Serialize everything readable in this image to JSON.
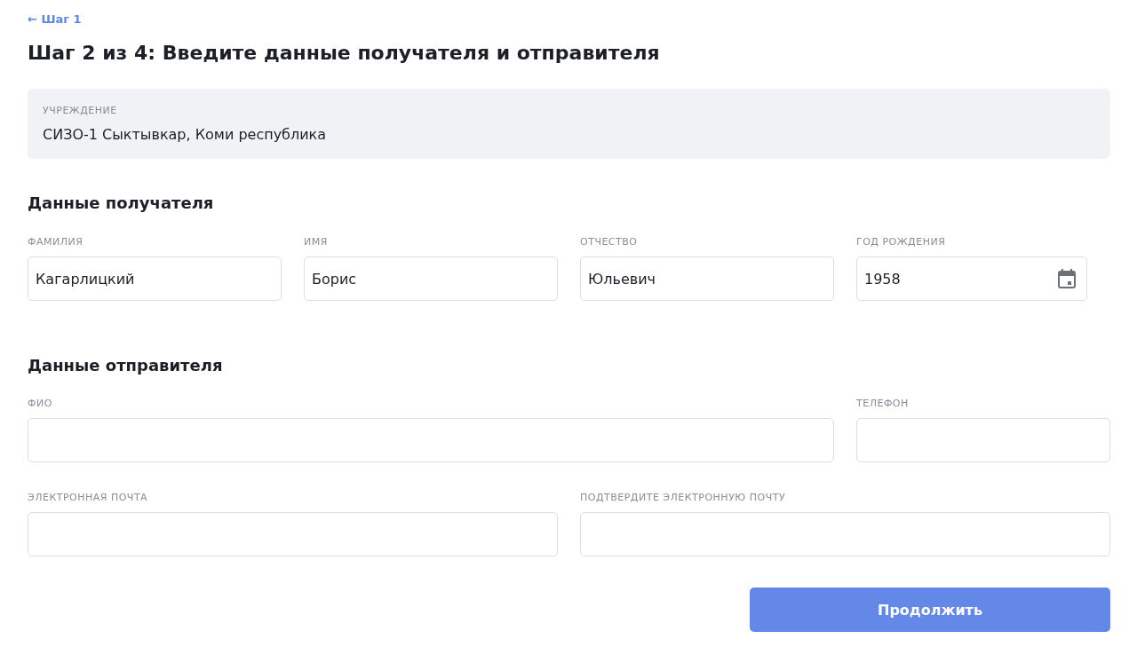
{
  "back_link": {
    "arrow": "←",
    "label": "Шаг 1"
  },
  "title": "Шаг 2 из 4: Введите данные получателя и отправителя",
  "institution": {
    "label": "УЧРЕЖДЕНИЕ",
    "value": "СИЗО-1 Сыктывкар, Коми республика"
  },
  "recipient": {
    "heading": "Данные получателя",
    "fields": [
      {
        "label": "ФАМИЛИЯ",
        "value": "Кагарлицкий",
        "kind": "text"
      },
      {
        "label": "ИМЯ",
        "value": "Борис",
        "kind": "text"
      },
      {
        "label": "ОТЧЕСТВО",
        "value": "Юльевич",
        "kind": "text"
      },
      {
        "label": "ГОД РОЖДЕНИЯ",
        "value": "1958",
        "kind": "date"
      }
    ]
  },
  "sender": {
    "heading": "Данные отправителя",
    "rows": [
      [
        {
          "label": "ФИО"
        },
        {
          "label": "ТЕЛЕФОН"
        }
      ],
      [
        {
          "label": "ЭЛЕКТРОННАЯ ПОЧТА"
        },
        {
          "label": "ПОДТВЕРДИТЕ ЭЛЕКТРОННУЮ ПОЧТУ"
        }
      ]
    ]
  },
  "continue_button": "Продолжить"
}
